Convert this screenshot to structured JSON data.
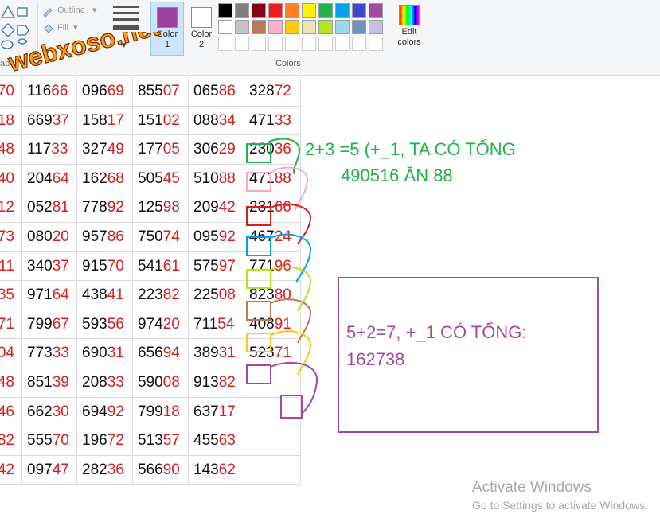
{
  "ribbon": {
    "shapes_label": "apes",
    "outline_label": "Outline",
    "fill_label": "Fill",
    "color1_label": "Color 1",
    "color2_label": "Color 2",
    "colors_group_label": "Colors",
    "edit_colors_label": "Edit colors",
    "color1_value": "#9b3fa0",
    "color2_value": "#ffffff",
    "palette_row1": [
      "#000000",
      "#7f7f7f",
      "#880015",
      "#ed1c24",
      "#ff7f27",
      "#fff200",
      "#22b14c",
      "#00a2e8",
      "#3f48cc",
      "#a349a4"
    ],
    "palette_row2": [
      "#ffffff",
      "#c3c3c3",
      "#b97a57",
      "#ffaec9",
      "#ffc90e",
      "#efe4b0",
      "#b5e61d",
      "#99d9ea",
      "#7092be",
      "#c8bfe7"
    ]
  },
  "logo": {
    "text": "webxoso.net"
  },
  "table": {
    "rows": [
      {
        "left": "70",
        "cells": [
          [
            "116",
            "66"
          ],
          [
            "096",
            "69"
          ],
          [
            "855",
            "07"
          ],
          [
            "065",
            "86"
          ],
          [
            "328",
            "72"
          ]
        ]
      },
      {
        "left": "18",
        "cells": [
          [
            "669",
            "37"
          ],
          [
            "158",
            "17"
          ],
          [
            "151",
            "02"
          ],
          [
            "088",
            "34"
          ],
          [
            "471",
            "33"
          ]
        ]
      },
      {
        "left": "48",
        "cells": [
          [
            "117",
            "33"
          ],
          [
            "327",
            "49"
          ],
          [
            "177",
            "05"
          ],
          [
            "306",
            "29"
          ],
          [
            "230",
            "36"
          ]
        ]
      },
      {
        "left": "40",
        "cells": [
          [
            "204",
            "64"
          ],
          [
            "162",
            "68"
          ],
          [
            "505",
            "45"
          ],
          [
            "510",
            "88"
          ],
          [
            "471",
            "88"
          ]
        ]
      },
      {
        "left": "12",
        "cells": [
          [
            "052",
            "81"
          ],
          [
            "778",
            "92"
          ],
          [
            "125",
            "98"
          ],
          [
            "209",
            "42"
          ],
          [
            "231",
            "66"
          ]
        ]
      },
      {
        "left": "73",
        "cells": [
          [
            "080",
            "20"
          ],
          [
            "957",
            "86"
          ],
          [
            "750",
            "74"
          ],
          [
            "095",
            "92"
          ],
          [
            "467",
            "24"
          ]
        ]
      },
      {
        "left": "11",
        "cells": [
          [
            "340",
            "37"
          ],
          [
            "915",
            "70"
          ],
          [
            "541",
            "61"
          ],
          [
            "575",
            "97"
          ],
          [
            "771",
            "96"
          ]
        ]
      },
      {
        "left": "35",
        "cells": [
          [
            "971",
            "64"
          ],
          [
            "438",
            "41"
          ],
          [
            "223",
            "82"
          ],
          [
            "225",
            "08"
          ],
          [
            "823",
            "80"
          ]
        ]
      },
      {
        "left": "71",
        "cells": [
          [
            "799",
            "67"
          ],
          [
            "593",
            "56"
          ],
          [
            "974",
            "20"
          ],
          [
            "711",
            "54"
          ],
          [
            "408",
            "91"
          ]
        ]
      },
      {
        "left": "04",
        "cells": [
          [
            "773",
            "33"
          ],
          [
            "690",
            "31"
          ],
          [
            "656",
            "94"
          ],
          [
            "389",
            "31"
          ],
          [
            "523",
            "71"
          ]
        ]
      },
      {
        "left": "48",
        "cells": [
          [
            "851",
            "39"
          ],
          [
            "208",
            "33"
          ],
          [
            "590",
            "08"
          ],
          [
            "913",
            "82"
          ],
          [
            "",
            ""
          ]
        ]
      },
      {
        "left": "46",
        "cells": [
          [
            "662",
            "30"
          ],
          [
            "694",
            "92"
          ],
          [
            "799",
            "18"
          ],
          [
            "637",
            "17"
          ],
          [
            "",
            ""
          ]
        ]
      },
      {
        "left": "82",
        "cells": [
          [
            "555",
            "70"
          ],
          [
            "196",
            "72"
          ],
          [
            "513",
            "57"
          ],
          [
            "455",
            "63"
          ],
          [
            "",
            ""
          ]
        ]
      },
      {
        "left": "42",
        "cells": [
          [
            "097",
            "47"
          ],
          [
            "282",
            "36"
          ],
          [
            "566",
            "90"
          ],
          [
            "143",
            "62"
          ],
          [
            "",
            ""
          ]
        ]
      }
    ]
  },
  "annotations": {
    "green_line1": "2+3 =5 (+_1, TA CÓ TỔNG",
    "green_line2": "490516 ĂN 88",
    "purple_line1": "5+2=7, +_1 CÓ TỔNG:",
    "purple_line2": "162738",
    "green_color": "#22b14c",
    "purple_color": "#a349a4"
  },
  "watermark": {
    "title": "Activate Windows",
    "subtitle": "Go to Settings to activate Windows."
  }
}
